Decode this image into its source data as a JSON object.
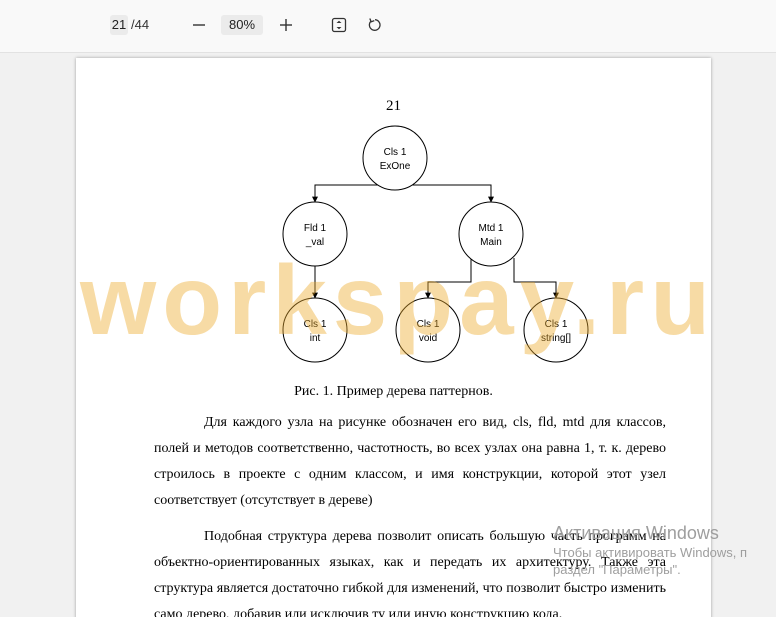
{
  "toolbar": {
    "current_page": "21",
    "page_separator": "/",
    "total_pages": "44",
    "zoom": "80%",
    "icons": [
      "zoom-out-icon",
      "zoom-in-icon",
      "fit-page-icon",
      "rotate-icon"
    ]
  },
  "document": {
    "page_number": "21",
    "tree": {
      "nodes": [
        {
          "id": "cls1",
          "line1": "Cls 1",
          "line2": "ExOne"
        },
        {
          "id": "fld1",
          "line1": "Fld 1",
          "line2": "_val"
        },
        {
          "id": "mtd1",
          "line1": "Mtd 1",
          "line2": "Main"
        },
        {
          "id": "cls_int",
          "line1": "Cls 1",
          "line2": "int"
        },
        {
          "id": "cls_void",
          "line1": "Cls 1",
          "line2": "void"
        },
        {
          "id": "cls_string",
          "line1": "Cls 1",
          "line2": "string[]"
        }
      ]
    },
    "caption": "Рис. 1. Пример дерева паттернов.",
    "paragraph1": "Для каждого узла на рисунке обозначен его вид, cls, fld, mtd для классов, полей и методов соответственно, частотность, во всех узлах она равна 1, т. к. дерево строилось в проекте с одним классом, и имя конструкции, которой этот узел соответствует (отсутствует в дереве)",
    "paragraph2": "Подобная структура дерева позволит описать большую часть программ на объектно-ориентированных языках, как и передать их архитектуру. Также эта структура является достаточно гибкой для изменений, что позволит быстро изменить само дерево, добавив или исключив ту или иную конструкцию кода."
  },
  "watermark": "workspay.ru",
  "os_overlay": {
    "line1": "Активация Windows",
    "line2": "Чтобы активировать Windows, п",
    "line3": "раздел \"Параметры\"."
  }
}
